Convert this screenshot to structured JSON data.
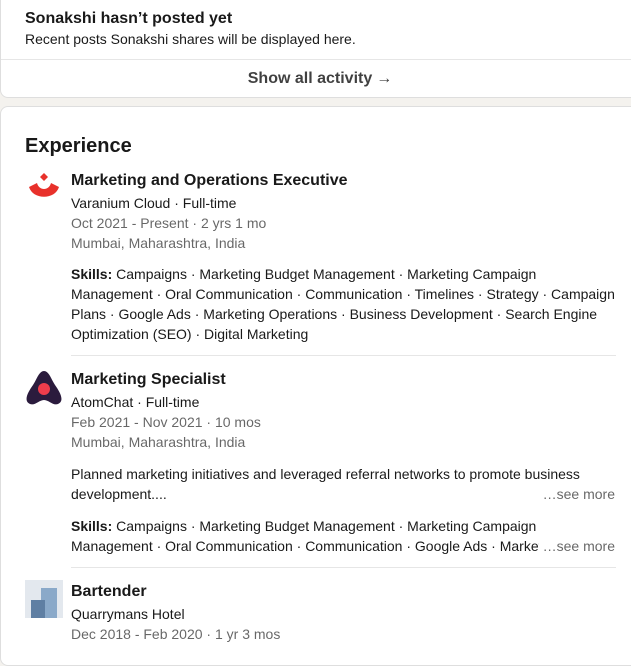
{
  "posts": {
    "title": "Sonakshi hasn’t posted yet",
    "subtitle": "Recent posts Sonakshi shares will be displayed here.",
    "show_all_label": "Show all activity",
    "arrow": "→"
  },
  "experience": {
    "section_title": "Experience",
    "items": [
      {
        "logo": "varanium-cloud-logo",
        "role": "Marketing and Operations Executive",
        "company": "Varanium Cloud · Full-time",
        "dates": "Oct 2021 - Present · 2 yrs 1 mo",
        "location": "Mumbai, Maharashtra, India",
        "skills_label": "Skills:",
        "skills_line1": "Campaigns · Marketing Budget Management · Marketing Campaign",
        "skills_line2": "Management · Oral Communication · Communication · Timelines · Strategy · Campaign",
        "skills_line3": "Plans · Google Ads · Marketing Operations · Business Development · Search Engine",
        "skills_line4": "Optimization (SEO) · Digital Marketing"
      },
      {
        "logo": "atomchat-logo",
        "role": "Marketing Specialist",
        "company": "AtomChat · Full-time",
        "dates": "Feb 2021 - Nov 2021 · 10 mos",
        "location": "Mumbai, Maharashtra, India",
        "desc_line1": "Planned marketing initiatives and leveraged referral networks to promote business",
        "desc_line2": "development....",
        "see_more": "…see more",
        "skills_label": "Skills:",
        "skills_line1": "Campaigns · Marketing Budget Management · Marketing Campaign",
        "skills_line2": "Management · Oral Communication · Communication · Google Ads · Marketing",
        "skills_see_more": "…see more"
      },
      {
        "logo": "quarrymans-hotel-logo",
        "role": "Bartender",
        "company": "Quarrymans Hotel",
        "dates": "Dec 2018 - Feb 2020 · 1 yr 3 mos"
      }
    ]
  },
  "colors": {
    "varanium_red": "#e8312b",
    "atomchat_dark": "#2b1b3d",
    "atomchat_red": "#ef3d4c",
    "quarrymans_blue": "#8aa9c9"
  }
}
